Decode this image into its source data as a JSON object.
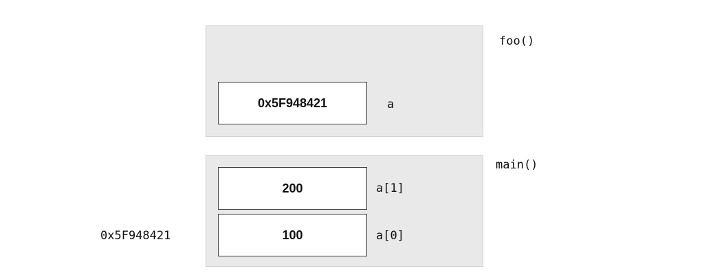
{
  "frames": {
    "foo": {
      "title": "foo()",
      "cells": [
        {
          "value": "0x5F948421",
          "label": "a"
        }
      ]
    },
    "main": {
      "title": "main()",
      "cells": [
        {
          "value": "200",
          "label": "a[1]"
        },
        {
          "value": "100",
          "label": "a[0]"
        }
      ]
    }
  },
  "address": "0x5F948421",
  "colors": {
    "frame_bg": "#e9e9e9",
    "frame_border": "#cfcfcf",
    "cell_bg": "#ffffff",
    "cell_border": "#3a3a3a",
    "text": "#111111"
  }
}
